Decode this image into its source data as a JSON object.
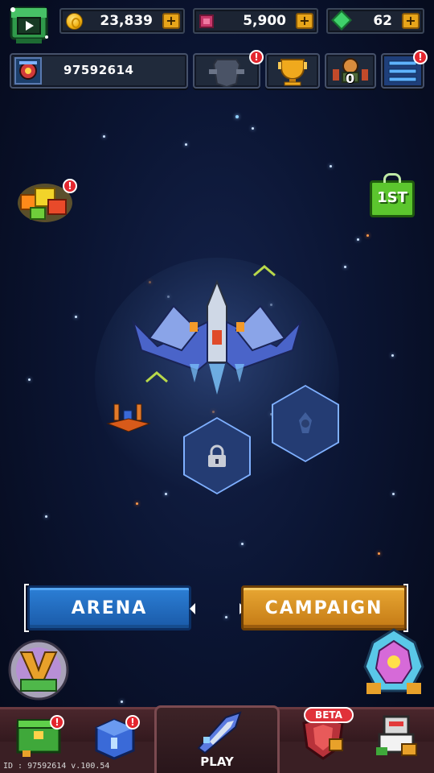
{
  "resources": {
    "coins": "23,839",
    "tickets": "5,900",
    "gems": "62",
    "plus": "+"
  },
  "player": {
    "id": "97592614"
  },
  "badges": {
    "alert": "!",
    "pass_count": "0"
  },
  "rewards": {
    "first_pack_label": "1ST"
  },
  "modes": {
    "arena": "ARENA",
    "campaign": "CAMPAIGN"
  },
  "nav": {
    "play": "PLAY",
    "beta": "BETA"
  },
  "footer": {
    "version": "ID : 97592614 v.100.54"
  },
  "colors": {
    "arena_blue": "#2c7fd6",
    "campaign_orange": "#e8a733",
    "badge_red": "#e3262e",
    "background": "#0b1533"
  }
}
